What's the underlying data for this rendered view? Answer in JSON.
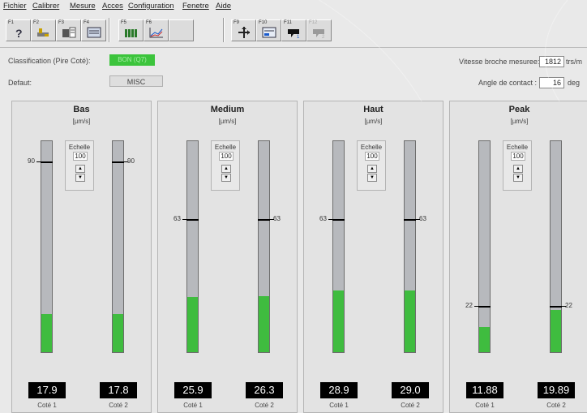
{
  "menu": [
    "Fichier",
    "Calibrer",
    "Mesure",
    "Acces",
    "Configuration",
    "Fenetre",
    "Aide"
  ],
  "toolbar": [
    {
      "key": "F1",
      "icon": "help-icon",
      "enabled": true
    },
    {
      "key": "F2",
      "icon": "wrench-icon",
      "enabled": true
    },
    {
      "key": "F3",
      "icon": "calibrate-icon",
      "enabled": true
    },
    {
      "key": "F4",
      "icon": "display-icon",
      "enabled": true
    },
    {
      "key": "F5",
      "icon": "bar-gauge-icon",
      "enabled": true
    },
    {
      "key": "F6",
      "icon": "curve-icon",
      "enabled": true
    },
    {
      "key": "F9",
      "icon": "move-icon",
      "enabled": true
    },
    {
      "key": "F10",
      "icon": "report-icon",
      "enabled": true
    },
    {
      "key": "F11",
      "icon": "tool-1-icon",
      "enabled": true
    },
    {
      "key": "F12",
      "icon": "tool-2-icon",
      "enabled": false
    }
  ],
  "info": {
    "classification_label": "Classification (Pire Coté):",
    "classification_value": "BON (Q7)",
    "defaut_label": "Defaut:",
    "defaut_value": "MISC",
    "vitesse_label": "Vitesse broche mesuree:",
    "vitesse_value": "1812",
    "vitesse_unit": "trs/m",
    "angle_label": "Angle de contact :",
    "angle_value": "16",
    "angle_unit": "deg"
  },
  "colors": {
    "fill": "#3fbc3f",
    "classification_badge": "#3cc43c",
    "readout_bg": "#000000"
  },
  "panels": [
    {
      "title": "Bas",
      "unit": "[µm/s]",
      "echelle_label": "Echelle",
      "echelle_value": "100",
      "sides": [
        {
          "label": "Coté 1",
          "value": "17.9",
          "fill_pct": 17.9,
          "marker_pct": 90,
          "marker_label": "90"
        },
        {
          "label": "Coté 2",
          "value": "17.8",
          "fill_pct": 17.8,
          "marker_pct": 90,
          "marker_label": "90"
        }
      ]
    },
    {
      "title": "Medium",
      "unit": "[µm/s]",
      "echelle_label": "Echelle",
      "echelle_value": "100",
      "sides": [
        {
          "label": "Coté 1",
          "value": "25.9",
          "fill_pct": 25.9,
          "marker_pct": 63,
          "marker_label": "63"
        },
        {
          "label": "Coté 2",
          "value": "26.3",
          "fill_pct": 26.3,
          "marker_pct": 63,
          "marker_label": "63"
        }
      ]
    },
    {
      "title": "Haut",
      "unit": "[µm/s]",
      "echelle_label": "Echelle",
      "echelle_value": "100",
      "sides": [
        {
          "label": "Coté 1",
          "value": "28.9",
          "fill_pct": 28.9,
          "marker_pct": 63,
          "marker_label": "63"
        },
        {
          "label": "Coté 2",
          "value": "29.0",
          "fill_pct": 29.0,
          "marker_pct": 63,
          "marker_label": "63"
        }
      ]
    },
    {
      "title": "Peak",
      "unit": "[µm/s]",
      "echelle_label": "Echelle",
      "echelle_value": "100",
      "sides": [
        {
          "label": "Coté 1",
          "value": "11.88",
          "fill_pct": 11.88,
          "marker_pct": 22,
          "marker_label": "22"
        },
        {
          "label": "Coté 2",
          "value": "19.89",
          "fill_pct": 19.89,
          "marker_pct": 22,
          "marker_label": "22"
        }
      ]
    }
  ]
}
